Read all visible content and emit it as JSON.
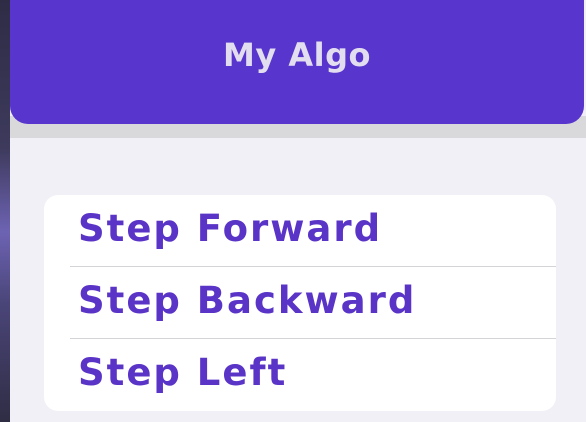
{
  "header": {
    "title": "My Algo"
  },
  "menu": {
    "items": [
      {
        "label": "Step Forward"
      },
      {
        "label": "Step Backward"
      },
      {
        "label": "Step Left"
      }
    ]
  },
  "colors": {
    "header_bg": "#5835cc",
    "header_text": "#e2def0",
    "item_text": "#5a34c6",
    "panel_bg": "#f1f0f6",
    "card_bg": "#ffffff"
  }
}
